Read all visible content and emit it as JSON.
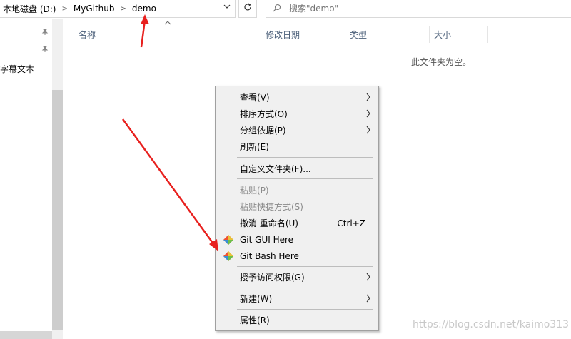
{
  "address_bar": {
    "crumbs": [
      "本地磁盘 (D:)",
      "MyGithub",
      "demo"
    ],
    "separator": ">"
  },
  "search": {
    "placeholder": "搜索\"demo\""
  },
  "nav": {
    "text": "英字幕文本"
  },
  "columns": [
    "名称",
    "修改日期",
    "类型",
    "大小"
  ],
  "empty_message": "此文件夹为空。",
  "context_menu": {
    "items": [
      {
        "label": "查看(V)",
        "submenu": true
      },
      {
        "label": "排序方式(O)",
        "submenu": true
      },
      {
        "label": "分组依据(P)",
        "submenu": true
      },
      {
        "label": "刷新(E)"
      },
      {
        "label": "自定义文件夹(F)..."
      },
      {
        "label": "粘贴(P)",
        "disabled": true
      },
      {
        "label": "粘贴快捷方式(S)",
        "disabled": true
      },
      {
        "label": "撤消 重命名(U)",
        "shortcut": "Ctrl+Z"
      },
      {
        "label": "Git GUI Here",
        "icon": "git-icon"
      },
      {
        "label": "Git Bash Here",
        "icon": "git-icon"
      },
      {
        "label": "授予访问权限(G)",
        "submenu": true
      },
      {
        "label": "新建(W)",
        "submenu": true
      },
      {
        "label": "属性(R)"
      }
    ]
  },
  "watermark": "https://blog.csdn.net/kaimo313",
  "colors": {
    "menu_bg": "#f0f0f0",
    "annotation_red": "#e8201e",
    "header_text": "#4c607a"
  }
}
